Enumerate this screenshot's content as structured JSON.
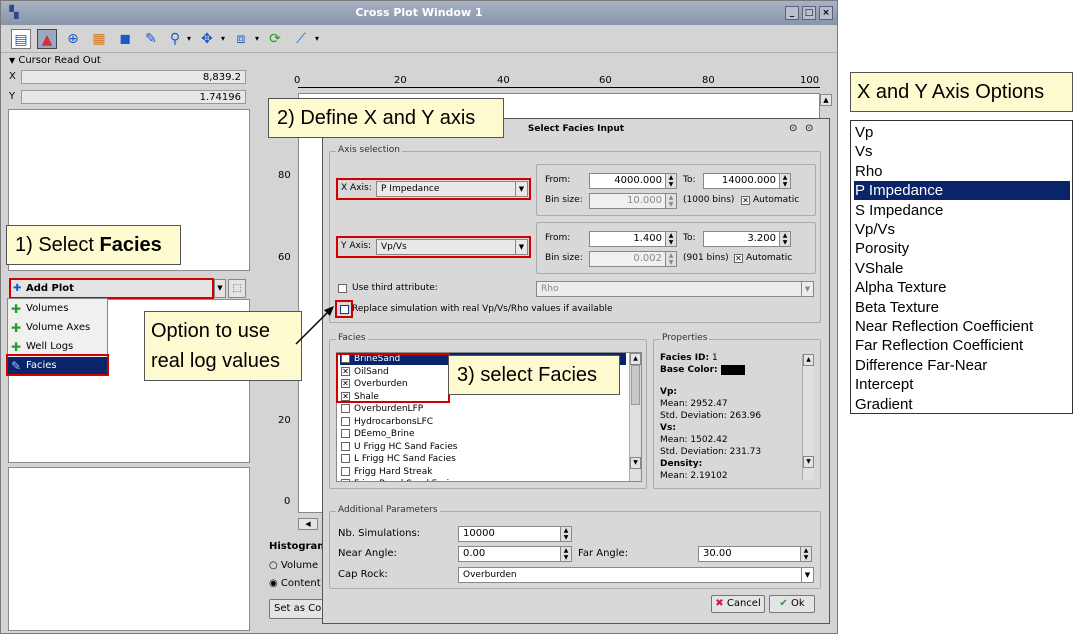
{
  "window": {
    "title": "Cross Plot Window 1",
    "min": "_",
    "max": "□",
    "close": "×"
  },
  "cursor": {
    "label": "Cursor Read Out",
    "x_label": "X",
    "x_value": "8,839.2",
    "y_label": "Y",
    "y_value": "1.74196"
  },
  "add_plot": {
    "label": "Add Plot",
    "menu": [
      "Volumes",
      "Volume Axes",
      "Well Logs",
      "Facies"
    ]
  },
  "histogram": {
    "label": "Histogram",
    "opt1": "Volume",
    "opt2": "Content",
    "set_btn": "Set as Co"
  },
  "plot_axis": {
    "top_ticks": [
      "0",
      "20",
      "40",
      "60",
      "80",
      "100"
    ],
    "left_ticks": [
      "80",
      "60",
      "40",
      "20",
      "0"
    ]
  },
  "callouts": {
    "c1_prefix": "1) Select ",
    "c1_bold": "Facies",
    "c2": "2)  Define X and Y axis",
    "c3": "3) select Facies",
    "c4_line1": "Option to use",
    "c4_line2": "real log values"
  },
  "dialog": {
    "title": "Select Facies Input",
    "axis_group": "Axis selection",
    "x_axis_label": "X Axis:",
    "x_axis_value": "P Impedance",
    "y_axis_label": "Y Axis:",
    "y_axis_value": "Vp/Vs",
    "from_label": "From:",
    "to_label": "To:",
    "bin_label": "Bin size:",
    "x_from": "4000.000",
    "x_to": "14000.000",
    "x_bin": "10.000",
    "x_bins_text": "(1000 bins)",
    "y_from": "1.400",
    "y_to": "3.200",
    "y_bin": "0.002",
    "y_bins_text": "(901 bins)",
    "automatic": "Automatic",
    "third_attr": "Use third attribute:",
    "third_value": "Rho",
    "replace_text": "Replace simulation with real Vp/Vs/Rho values if available",
    "facies_group": "Facies",
    "facies": [
      {
        "name": "BrineSand",
        "checked": false,
        "selected": true
      },
      {
        "name": "OilSand",
        "checked": true,
        "selected": false
      },
      {
        "name": "Overburden",
        "checked": true,
        "selected": false
      },
      {
        "name": "Shale",
        "checked": true,
        "selected": false
      },
      {
        "name": "OverburdenLFP",
        "checked": false,
        "selected": false
      },
      {
        "name": "HydrocarbonsLFC",
        "checked": false,
        "selected": false
      },
      {
        "name": "DEemo_Brine",
        "checked": false,
        "selected": false
      },
      {
        "name": "U Frigg HC Sand Facies",
        "checked": false,
        "selected": false
      },
      {
        "name": "L Frigg HC Sand Facies",
        "checked": false,
        "selected": false
      },
      {
        "name": "Frigg Hard Streak",
        "checked": false,
        "selected": false
      },
      {
        "name": "Frigg Basal Sand Facies",
        "checked": false,
        "selected": false
      }
    ],
    "props_group": "Properties",
    "props": {
      "facies_id_label": "Facies ID:",
      "facies_id": "1",
      "base_color_label": "Base Color:",
      "vp_label": "Vp:",
      "vp_mean": "Mean: 2952.47",
      "vp_std": "Std. Deviation: 263.96",
      "vs_label": "Vs:",
      "vs_mean": "Mean: 1502.42",
      "vs_std": "Std. Deviation: 231.73",
      "density_label": "Density:",
      "density_mean": "Mean: 2.19102"
    },
    "add_group": "Additional Parameters",
    "nb_sim_label": "Nb. Simulations:",
    "nb_sim": "10000",
    "near_label": "Near Angle:",
    "near": "0.00",
    "far_label": "Far Angle:",
    "far": "30.00",
    "cap_label": "Cap Rock:",
    "cap": "Overburden",
    "cancel": "Cancel",
    "ok": "Ok"
  },
  "axis_options": {
    "title": "X and Y Axis Options",
    "items": [
      "Vp",
      "Vs",
      "Rho",
      "P Impedance",
      "S Impedance",
      "Vp/Vs",
      "Porosity",
      "VShale",
      "Alpha Texture",
      "Beta Texture",
      "Near Reflection Coefficient",
      "Far Reflection Coefficient",
      "Difference Far-Near",
      "Intercept",
      "Gradient"
    ],
    "selected": "P Impedance"
  }
}
